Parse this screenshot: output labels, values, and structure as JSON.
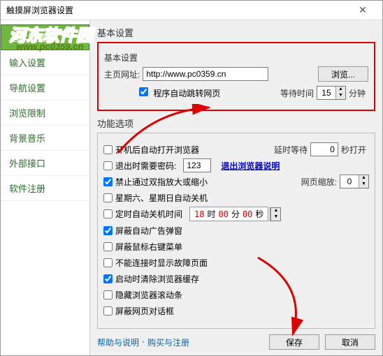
{
  "window": {
    "title": "触摸屏浏览器设置"
  },
  "watermark": {
    "text": "河东软件园",
    "url": "www.pc0359.cn"
  },
  "sidebar": {
    "items": [
      {
        "label": "基本设置"
      },
      {
        "label": "输入设置"
      },
      {
        "label": "导航设置"
      },
      {
        "label": "浏览限制"
      },
      {
        "label": "背景音乐"
      },
      {
        "label": "外部接口"
      },
      {
        "label": "软件注册"
      }
    ]
  },
  "basic": {
    "heading": "基本设置",
    "group_label": "基本设置",
    "home_label": "主页网址:",
    "home_value": "http://www.pc0359.cn",
    "browse_btn": "浏览...",
    "auto_jump_label": "程序自动跳转网页",
    "wait_label": "等待时间",
    "wait_value": "15",
    "wait_unit": "分钟"
  },
  "options": {
    "heading": "功能选项",
    "o1": {
      "label": "开机后自动打开浏览器",
      "delay_label": "延时等待",
      "delay_value": "0",
      "delay_unit": "秒打开"
    },
    "o2": {
      "label": "退出时需要密码:",
      "pwd_value": "123",
      "link": "退出浏览器说明"
    },
    "o3": {
      "label": "禁止通过双指放大或缩小",
      "zoom_label": "网页缩放:",
      "zoom_value": "0"
    },
    "o4": {
      "label": "星期六、星期日自动关机"
    },
    "o5": {
      "label": "定时自动关机时间",
      "hh": "18",
      "mm": "00",
      "ss": "00",
      "h_unit": "时",
      "m_unit": "分",
      "s_unit": "秒"
    },
    "o6": {
      "label": "屏蔽自动广告弹窗"
    },
    "o7": {
      "label": "屏蔽鼠标右键菜单"
    },
    "o8": {
      "label": "不能连接时显示故障页面"
    },
    "o9": {
      "label": "启动时清除浏览器缓存"
    },
    "o10": {
      "label": "隐藏浏览器滚动条"
    },
    "o11": {
      "label": "屏蔽网页对话框"
    }
  },
  "footer": {
    "help": "帮助与说明",
    "dot": "·",
    "buy": "购买与注册",
    "save": "保存",
    "cancel": "取消"
  }
}
